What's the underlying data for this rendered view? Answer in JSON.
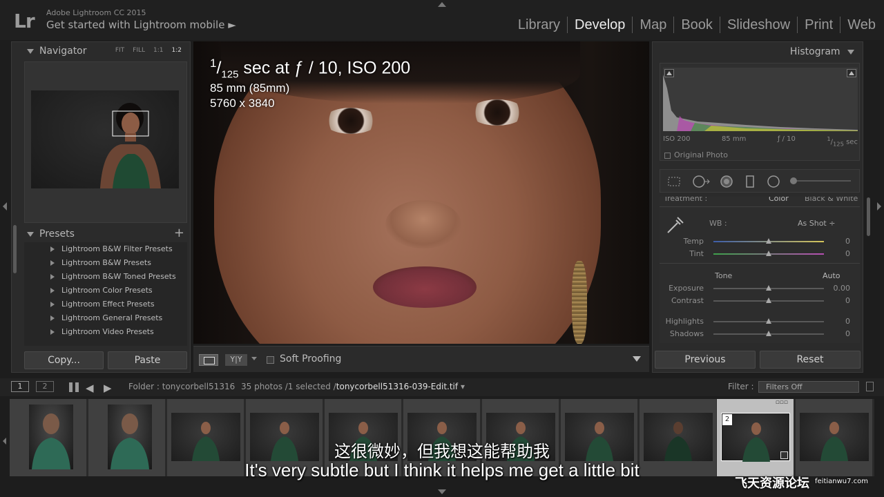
{
  "app": {
    "logo": "Lr",
    "version": "Adobe Lightroom CC 2015",
    "mobile_link": "Get started with Lightroom mobile ►"
  },
  "modules": [
    "Library",
    "Develop",
    "Map",
    "Book",
    "Slideshow",
    "Print",
    "Web"
  ],
  "active_module": "Develop",
  "navigator": {
    "title": "Navigator",
    "zoom_options": [
      "FIT",
      "FILL",
      "1:1",
      "1:2"
    ],
    "zoom_selected": "1:2"
  },
  "presets": {
    "title": "Presets",
    "add": "+",
    "items": [
      "Lightroom B&W Filter Presets",
      "Lightroom B&W Presets",
      "Lightroom B&W Toned Presets",
      "Lightroom Color Presets",
      "Lightroom Effect Presets",
      "Lightroom General Presets",
      "Lightroom Video Presets"
    ]
  },
  "left_buttons": {
    "copy": "Copy...",
    "paste": "Paste"
  },
  "photo_info": {
    "shutter_num": "1",
    "shutter_den": "125",
    "shutter_rest": " sec at ƒ / 10, ISO 200",
    "focal": "85 mm (85mm)",
    "dimensions": "5760 x 3840"
  },
  "toolbar": {
    "yy": "Y|Y",
    "soft_proofing": "Soft Proofing"
  },
  "histogram": {
    "title": "Histogram",
    "iso": "ISO 200",
    "focal": "85 mm",
    "aperture": "ƒ / 10",
    "shutter_num": "1",
    "shutter_den": "125",
    "shutter_unit": "sec",
    "original_photo": "Original Photo"
  },
  "basic": {
    "treatment_label": "Treatment :",
    "treatment_color": "Color",
    "treatment_bw": "Black & White",
    "wb_label": "WB :",
    "wb_value": "As Shot ÷",
    "temp_label": "Temp",
    "temp_value": "0",
    "tint_label": "Tint",
    "tint_value": "0",
    "tone_label": "Tone",
    "auto_label": "Auto",
    "exposure_label": "Exposure",
    "exposure_value": "0.00",
    "contrast_label": "Contrast",
    "contrast_value": "0",
    "highlights_label": "Highlights",
    "highlights_value": "0",
    "shadows_label": "Shadows",
    "shadows_value": "0"
  },
  "right_buttons": {
    "previous": "Previous",
    "reset": "Reset"
  },
  "filmstrip_bar": {
    "screen1": "1",
    "screen2": "2",
    "folder": "Folder : tonycorbell51316",
    "count": "35 photos /1 selected /",
    "file": "tonycorbell51316-039-Edit.tif",
    "file_arrow": " ▾",
    "filter_label": "Filter :",
    "filter_value": "Filters Off"
  },
  "filmstrip": {
    "selected_badge": "2",
    "selected_dots": "▫▫▫"
  },
  "subtitles": {
    "cn": "这很微妙，但我想这能帮助我",
    "en": "It's very subtle but I think it helps me get a little bit"
  },
  "watermark": {
    "text": "飞天资源论坛",
    "url": "feitianwu7.com"
  }
}
